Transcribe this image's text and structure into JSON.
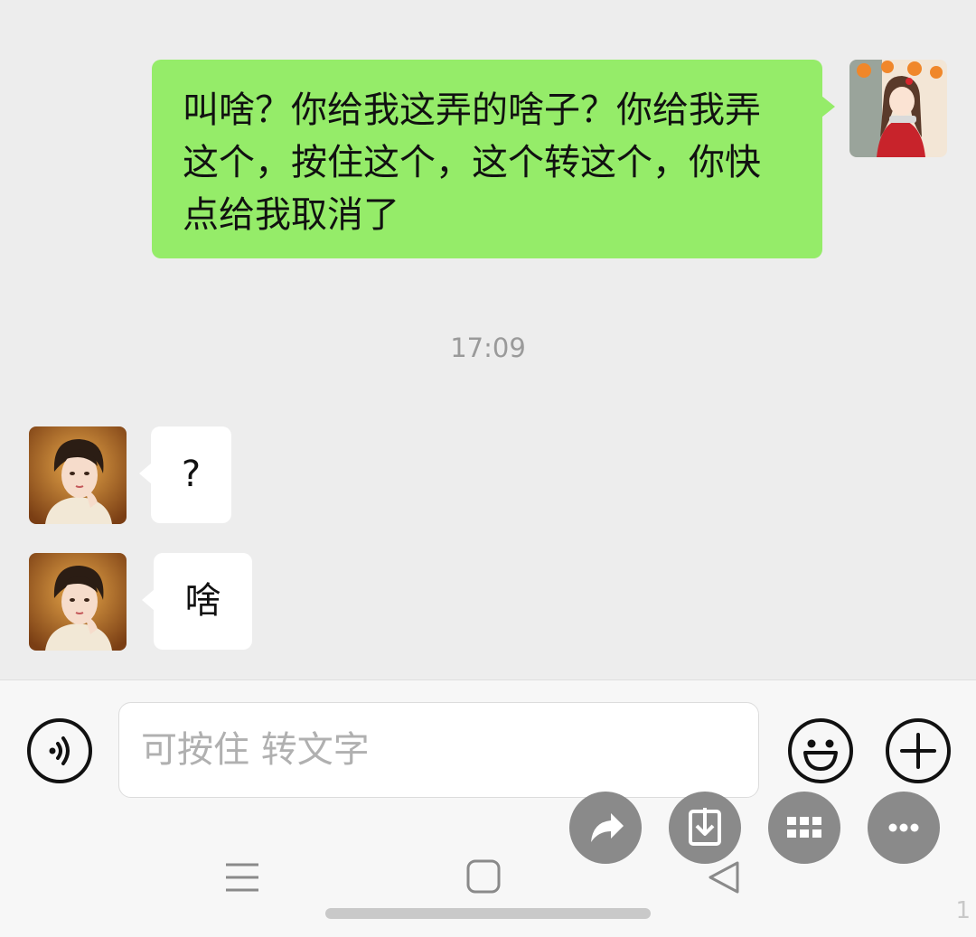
{
  "messages": {
    "outgoing_text": "叫啥？你给我这弄的啥子？你给我弄这个，按住这个，这个转这个，你快点给我取消了",
    "timestamp": "17:09",
    "incoming": [
      {
        "text": "?"
      },
      {
        "text": "啥"
      }
    ]
  },
  "input": {
    "placeholder": "可按住 转文字"
  },
  "watermark": "1",
  "colors": {
    "outgoing_bubble": "#95ec69",
    "incoming_bubble": "#ffffff",
    "chat_background": "#ededed",
    "fab": "#8a8a8a"
  }
}
